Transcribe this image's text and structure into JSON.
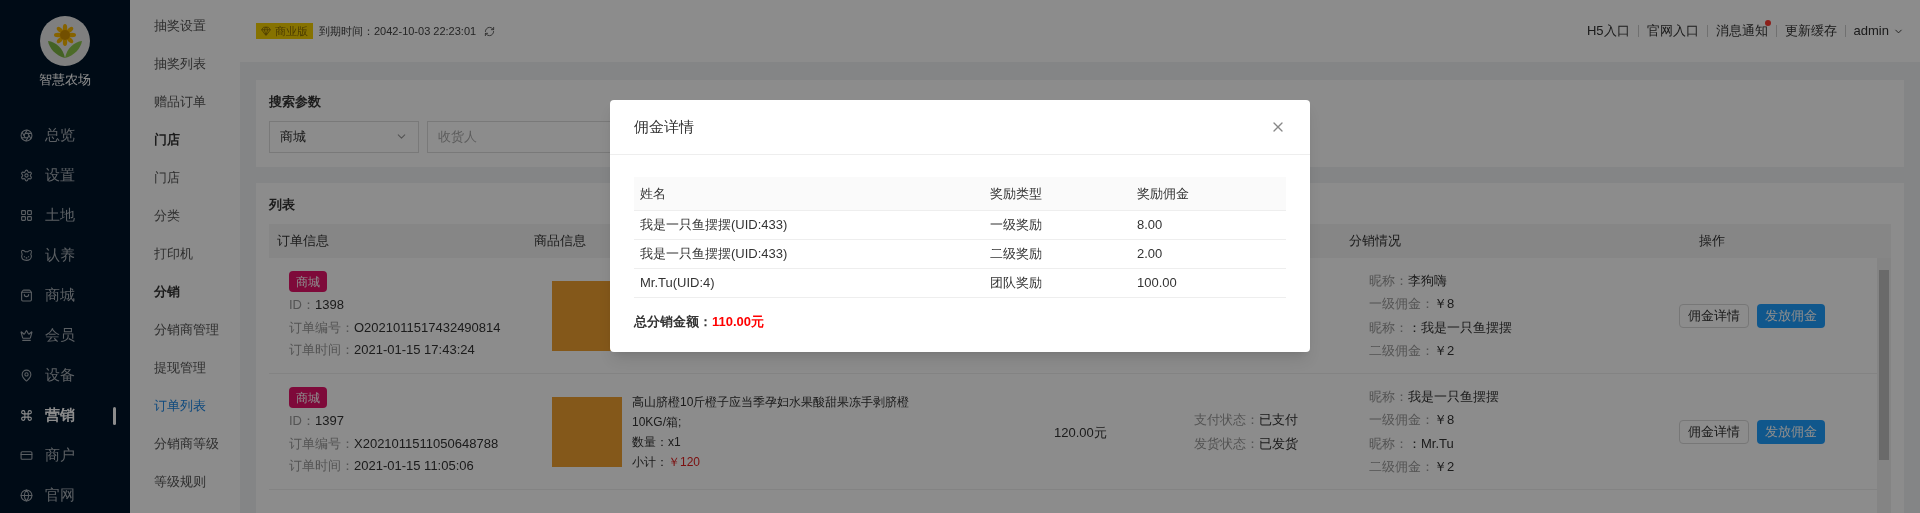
{
  "brand": {
    "name": "智慧农场"
  },
  "nav": [
    {
      "label": "总览",
      "selected": false
    },
    {
      "label": "设置",
      "selected": false
    },
    {
      "label": "土地",
      "selected": false
    },
    {
      "label": "认养",
      "selected": false
    },
    {
      "label": "商城",
      "selected": false
    },
    {
      "label": "会员",
      "selected": false
    },
    {
      "label": "设备",
      "selected": false
    },
    {
      "label": "营销",
      "selected": true
    },
    {
      "label": "商户",
      "selected": false
    },
    {
      "label": "官网",
      "selected": false
    }
  ],
  "subnav": [
    {
      "kind": "link",
      "label": "抽奖设置",
      "selected": false
    },
    {
      "kind": "link",
      "label": "抽奖列表",
      "selected": false
    },
    {
      "kind": "link",
      "label": "赠品订单",
      "selected": false
    },
    {
      "kind": "heading",
      "label": "门店"
    },
    {
      "kind": "link",
      "label": "门店",
      "selected": false
    },
    {
      "kind": "link",
      "label": "分类",
      "selected": false
    },
    {
      "kind": "link",
      "label": "打印机",
      "selected": false
    },
    {
      "kind": "heading",
      "label": "分销"
    },
    {
      "kind": "link",
      "label": "分销商管理",
      "selected": false
    },
    {
      "kind": "link",
      "label": "提现管理",
      "selected": false
    },
    {
      "kind": "link",
      "label": "订单列表",
      "selected": true
    },
    {
      "kind": "link",
      "label": "分销商等级",
      "selected": false
    },
    {
      "kind": "link",
      "label": "等级规则",
      "selected": false
    }
  ],
  "topbar": {
    "edition": "商业版",
    "expiry_label": "到期时间：",
    "expiry": "2042-10-03 22:23:01",
    "links": [
      {
        "label": "H5入口",
        "badge": false
      },
      {
        "label": "官网入口",
        "badge": false
      },
      {
        "label": "消息通知",
        "badge": true
      },
      {
        "label": "更新缓存",
        "badge": false
      }
    ],
    "user": "admin"
  },
  "search": {
    "title": "搜索参数",
    "select": "商城",
    "placeholder": "收货人"
  },
  "list": {
    "title": "列表",
    "columns": {
      "order": "订单信息",
      "product": "商品信息",
      "distribution": "分销情况",
      "actions": "操作"
    },
    "rows": [
      {
        "tag": "商城",
        "id_label": "ID：",
        "id": "1398",
        "order_no_label": "订单编号：",
        "order_no": "O2021011517432490814",
        "time_label": "订单时间：",
        "time": "2021-01-15 17:43:24",
        "distribution": [
          {
            "label": "昵称：",
            "value": "李狗嗨"
          },
          {
            "label": "一级佣金：",
            "value": "￥8"
          },
          {
            "label": "昵称：",
            "value": "：我是一只鱼摆摆"
          },
          {
            "label": "二级佣金：",
            "value": "￥2"
          }
        ],
        "actions": [
          {
            "kind": "default",
            "label": "佣金详情"
          },
          {
            "kind": "primary",
            "label": "发放佣金"
          }
        ]
      },
      {
        "tag": "商城",
        "id_label": "ID：",
        "id": "1397",
        "order_no_label": "订单编号：",
        "order_no": "X2021011511050648788",
        "time_label": "订单时间：",
        "time": "2021-01-15 11:05:06",
        "product": {
          "title": "高山脐橙10斤橙子应当季孕妇水果酸甜果冻手剥脐橙",
          "spec": "10KG/箱;",
          "qty_label": "数量：",
          "qty": "x1",
          "subtotal_label": "小计：",
          "subtotal": "￥120"
        },
        "price": "120.00元",
        "pay_label": "支付状态：",
        "pay": "已支付",
        "ship_label": "发货状态：",
        "ship": "已发货",
        "distribution": [
          {
            "label": "昵称：",
            "value": "我是一只鱼摆摆"
          },
          {
            "label": "一级佣金：",
            "value": "￥8"
          },
          {
            "label": "昵称：",
            "value": "：Mr.Tu"
          },
          {
            "label": "二级佣金：",
            "value": "￥2"
          }
        ],
        "actions": [
          {
            "kind": "default",
            "label": "佣金详情"
          },
          {
            "kind": "primary",
            "label": "发放佣金"
          }
        ]
      }
    ]
  },
  "modal": {
    "title": "佣金详情",
    "columns": [
      "姓名",
      "奖励类型",
      "奖励佣金"
    ],
    "rows": [
      [
        "我是一只鱼摆摆(UID:433)",
        "一级奖励",
        "8.00"
      ],
      [
        "我是一只鱼摆摆(UID:433)",
        "二级奖励",
        "2.00"
      ],
      [
        "Mr.Tu(UID:4)",
        "团队奖励",
        "100.00"
      ]
    ],
    "total_label": "总分销金额：",
    "total": "110.00元"
  }
}
